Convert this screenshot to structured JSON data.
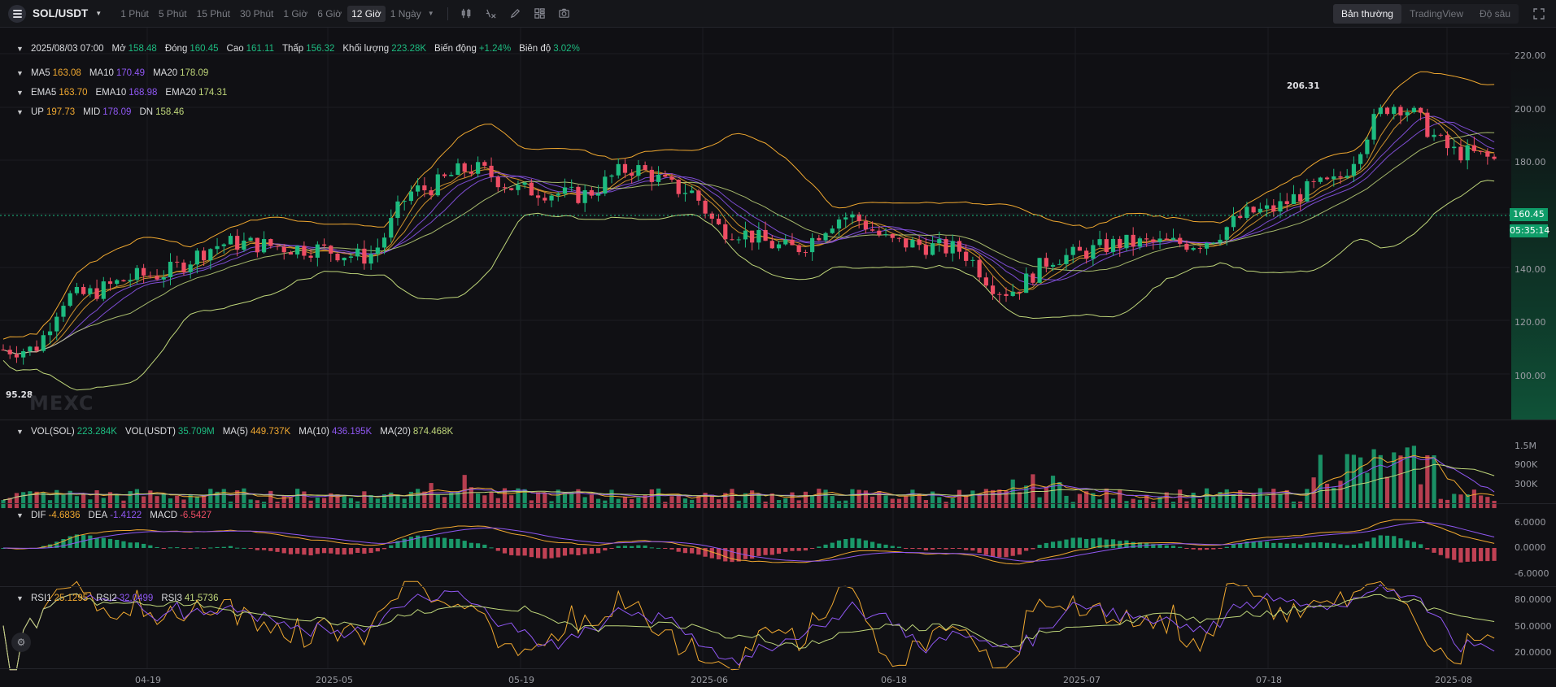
{
  "header": {
    "symbol": "SOL/USDT",
    "timeframes": [
      "1 Phút",
      "5 Phút",
      "15 Phút",
      "30 Phút",
      "1 Giờ",
      "6 Giờ",
      "12 Giờ"
    ],
    "active_timeframe": "12 Giờ",
    "more_timeframe": "1 Ngày",
    "tools": [
      "indicator-icon",
      "formula-icon",
      "draw-icon",
      "layout-icon",
      "camera-icon"
    ],
    "views": [
      "Bản thường",
      "TradingView",
      "Độ sâu"
    ],
    "active_view": "Bản thường"
  },
  "ohlc": {
    "date": "2025/08/03 07:00",
    "open_label": "Mở",
    "open": "158.48",
    "close_label": "Đóng",
    "close": "160.45",
    "high_label": "Cao",
    "high": "161.11",
    "low_label": "Thấp",
    "low": "156.32",
    "volume_label": "Khối lượng",
    "volume": "223.28K",
    "change_label": "Biến động",
    "change": "+1.24%",
    "amplitude_label": "Biên độ",
    "amplitude": "3.02%"
  },
  "ma": {
    "ma5_label": "MA5",
    "ma5": "163.08",
    "ma10_label": "MA10",
    "ma10": "170.49",
    "ma20_label": "MA20",
    "ma20": "178.09"
  },
  "ema": {
    "ema5_label": "EMA5",
    "ema5": "163.70",
    "ema10_label": "EMA10",
    "ema10": "168.98",
    "ema20_label": "EMA20",
    "ema20": "174.31"
  },
  "boll": {
    "up_label": "UP",
    "up": "197.73",
    "mid_label": "MID",
    "mid": "178.09",
    "dn_label": "DN",
    "dn": "158.46"
  },
  "volume_legend": {
    "vol_sol_label": "VOL(SOL)",
    "vol_sol": "223.284K",
    "vol_usdt_label": "VOL(USDT)",
    "vol_usdt": "35.709M",
    "ma5_label": "MA(5)",
    "ma5": "449.737K",
    "ma10_label": "MA(10)",
    "ma10": "436.195K",
    "ma20_label": "MA(20)",
    "ma20": "874.468K"
  },
  "macd_legend": {
    "dif_label": "DIF",
    "dif": "-4.6836",
    "dea_label": "DEA",
    "dea": "-1.4122",
    "macd_label": "MACD",
    "macd": "-6.5427"
  },
  "rsi_legend": {
    "rsi1_label": "RSI1",
    "rsi1": "25.1295",
    "rsi2_label": "RSI2",
    "rsi2": "32.0499",
    "rsi3_label": "RSI3",
    "rsi3": "41.5736"
  },
  "price_axis": [
    "220.00",
    "200.00",
    "180.00",
    "140.00",
    "120.00",
    "100.00"
  ],
  "volume_axis": [
    "1.5M",
    "900K",
    "300K"
  ],
  "macd_axis": [
    "6.0000",
    "0.0000",
    "-6.0000"
  ],
  "rsi_axis": [
    "80.0000",
    "50.0000",
    "20.0000"
  ],
  "time_axis": [
    "04-19",
    "2025-05",
    "05-19",
    "2025-06",
    "06-18",
    "2025-07",
    "07-18",
    "2025-08"
  ],
  "last_price": "160.45",
  "countdown": "05:35:14",
  "highest_mark": "206.31",
  "lowest_mark": "95.28",
  "watermark": "MEXC",
  "colors": {
    "up": "#1dbb80",
    "down": "#ee4d64",
    "ma5": "#f0a830",
    "ma10": "#8f57f2",
    "ma20": "#bfd67a"
  },
  "chart_data": {
    "type": "candlestick",
    "symbol": "SOL/USDT",
    "interval": "12 Giờ",
    "ylim": [
      90,
      225
    ],
    "anchors": [
      {
        "x": "04-10",
        "price": 110
      },
      {
        "x": "04-13",
        "price": 130
      },
      {
        "x": "04-19",
        "price": 138
      },
      {
        "x": "04-25",
        "price": 150
      },
      {
        "x": "05-01",
        "price": 148
      },
      {
        "x": "05-05",
        "price": 145
      },
      {
        "x": "05-09",
        "price": 170
      },
      {
        "x": "05-13",
        "price": 178
      },
      {
        "x": "05-17",
        "price": 170
      },
      {
        "x": "05-21",
        "price": 168
      },
      {
        "x": "05-25",
        "price": 178
      },
      {
        "x": "05-29",
        "price": 170
      },
      {
        "x": "06-01",
        "price": 155
      },
      {
        "x": "06-06",
        "price": 148
      },
      {
        "x": "06-10",
        "price": 160
      },
      {
        "x": "06-14",
        "price": 150
      },
      {
        "x": "06-18",
        "price": 148
      },
      {
        "x": "06-22",
        "price": 132
      },
      {
        "x": "06-26",
        "price": 145
      },
      {
        "x": "07-01",
        "price": 150
      },
      {
        "x": "07-06",
        "price": 150
      },
      {
        "x": "07-11",
        "price": 162
      },
      {
        "x": "07-16",
        "price": 172
      },
      {
        "x": "07-21",
        "price": 202
      },
      {
        "x": "07-26",
        "price": 184
      },
      {
        "x": "07-30",
        "price": 180
      },
      {
        "x": "08-03",
        "price": 160
      }
    ]
  }
}
